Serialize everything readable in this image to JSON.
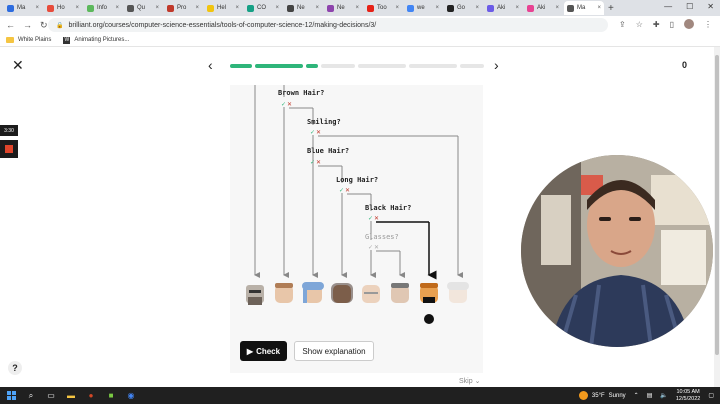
{
  "browser": {
    "tabs": [
      {
        "label": "Ma",
        "color": "#2d6cdf"
      },
      {
        "label": "Ho",
        "color": "#e74c3c"
      },
      {
        "label": "Info",
        "color": "#5cb85c"
      },
      {
        "label": "Qu",
        "color": "#555555"
      },
      {
        "label": "Pro",
        "color": "#c0392b"
      },
      {
        "label": "Hel",
        "color": "#f1c40f"
      },
      {
        "label": "CO",
        "color": "#16a085"
      },
      {
        "label": "Ne",
        "color": "#444444"
      },
      {
        "label": "Ne",
        "color": "#8e44ad"
      },
      {
        "label": "Too",
        "color": "#e62117"
      },
      {
        "label": "we",
        "color": "#4285f4"
      },
      {
        "label": "Go",
        "color": "#222222"
      },
      {
        "label": "Aki",
        "color": "#6c5ce7"
      },
      {
        "label": "Aki",
        "color": "#e84393"
      },
      {
        "label": "Ma",
        "color": "#555555",
        "active": true
      }
    ],
    "new_tab": "+",
    "url": "brilliant.org/courses/computer-science-essentials/tools-of-computer-science-12/making-decisions/3/",
    "bookmarks": [
      {
        "label": "White Plains",
        "icon": "folder-icon"
      },
      {
        "label": "Animating Pictures...",
        "icon": "w-icon"
      }
    ]
  },
  "lesson": {
    "progress": [
      {
        "done": true,
        "w": 22
      },
      {
        "done": true,
        "w": 48
      },
      {
        "done": true,
        "w": 12
      },
      {
        "done": false,
        "w": 34
      },
      {
        "done": false,
        "w": 48
      },
      {
        "done": false,
        "w": 48
      },
      {
        "done": false,
        "w": 24
      }
    ],
    "score": "0",
    "questions": {
      "brown_hair": "Brown Hair?",
      "smiling": "Smiling?",
      "blue_hair": "Blue Hair?",
      "long_hair": "Long Hair?",
      "black_hair": "Black Hair?",
      "glasses": "Glasses?"
    },
    "check_label": "Check",
    "explain_label": "Show explanation",
    "skip_label": "Skip"
  },
  "side_panel": {
    "timer": "3:30"
  },
  "taskbar": {
    "weather_temp": "35°F",
    "weather_desc": "Sunny",
    "time": "10:05 AM",
    "date": "12/5/2022"
  },
  "colors": {
    "accent": "#2eb57a",
    "button": "#111111",
    "cross": "#c0392b"
  }
}
